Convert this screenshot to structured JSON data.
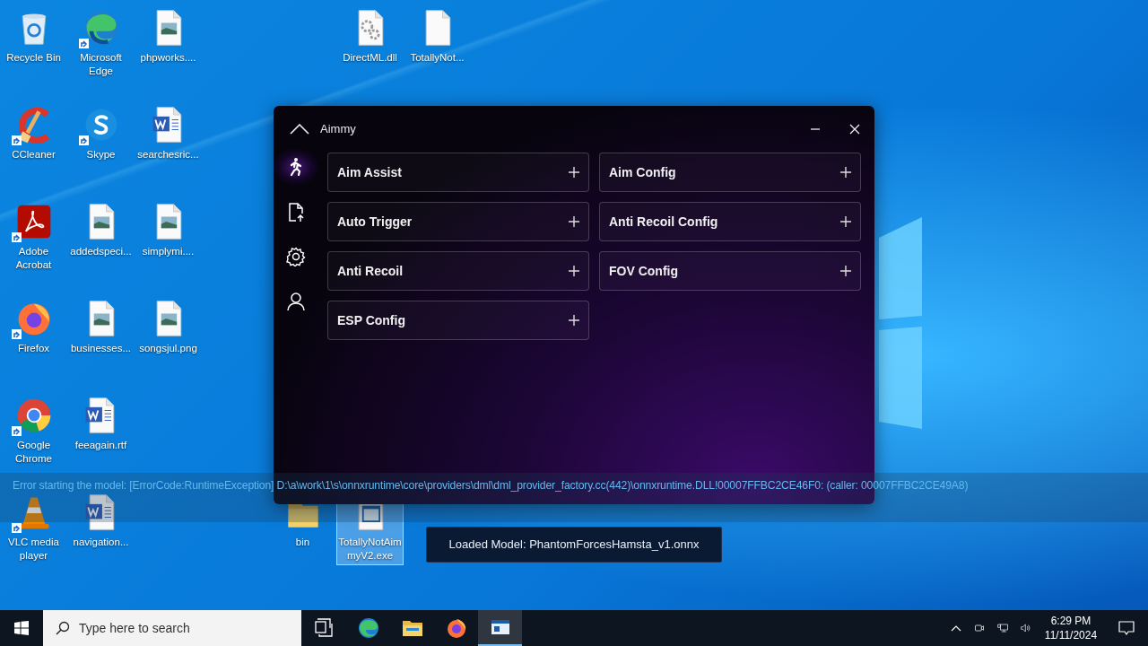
{
  "desktop_icons": [
    {
      "label": "Recycle Bin",
      "kind": "recycle",
      "shortcut": false,
      "selected": false
    },
    {
      "label": "CCleaner",
      "kind": "ccleaner",
      "shortcut": true,
      "selected": false
    },
    {
      "label": "Adobe Acrobat",
      "kind": "acrobat",
      "shortcut": true,
      "selected": false
    },
    {
      "label": "Firefox",
      "kind": "firefox",
      "shortcut": true,
      "selected": false
    },
    {
      "label": "Google Chrome",
      "kind": "chrome",
      "shortcut": true,
      "selected": false
    },
    {
      "label": "VLC media player",
      "kind": "vlc",
      "shortcut": true,
      "selected": false
    },
    {
      "label": "Microsoft Edge",
      "kind": "edge",
      "shortcut": true,
      "selected": false
    },
    {
      "label": "Skype",
      "kind": "skype",
      "shortcut": true,
      "selected": false
    },
    {
      "label": "addedspeci...",
      "kind": "image",
      "shortcut": false,
      "selected": false
    },
    {
      "label": "businesses...",
      "kind": "image",
      "shortcut": false,
      "selected": false
    },
    {
      "label": "feeagain.rtf",
      "kind": "word",
      "shortcut": false,
      "selected": false
    },
    {
      "label": "navigation...",
      "kind": "word",
      "shortcut": false,
      "selected": false
    },
    {
      "label": "phpworks....",
      "kind": "image",
      "shortcut": false,
      "selected": false
    },
    {
      "label": "searchesric...",
      "kind": "word",
      "shortcut": false,
      "selected": false
    },
    {
      "label": "simplymi....",
      "kind": "image",
      "shortcut": false,
      "selected": false
    },
    {
      "label": "songsjul.png",
      "kind": "image",
      "shortcut": false,
      "selected": false
    },
    {
      "label": "bin",
      "kind": "folder",
      "shortcut": false,
      "selected": false
    },
    {
      "label": "DirectML.dll",
      "kind": "dll",
      "shortcut": false,
      "selected": false
    },
    {
      "label": "TotallyNotAimmyV2.exe",
      "kind": "exe",
      "shortcut": false,
      "selected": true
    },
    {
      "label": "TotallyNot...",
      "kind": "blank",
      "shortcut": false,
      "selected": false
    }
  ],
  "app_window": {
    "title": "Aimmy",
    "sidebar": [
      {
        "kind": "runner",
        "selected": true
      },
      {
        "kind": "file-upload",
        "selected": false
      },
      {
        "kind": "gear",
        "selected": false
      },
      {
        "kind": "person",
        "selected": false
      }
    ],
    "columns": [
      [
        {
          "title": "Aim Assist",
          "expanded": false
        },
        {
          "title": "Auto Trigger",
          "expanded": false
        },
        {
          "title": "Anti Recoil",
          "expanded": false
        },
        {
          "title": "ESP Config",
          "expanded": false
        }
      ],
      [
        {
          "title": "Aim Config",
          "expanded": false
        },
        {
          "title": "Anti Recoil Config",
          "expanded": false
        },
        {
          "title": "FOV Config",
          "expanded": false
        }
      ]
    ]
  },
  "error_banner": "Error starting the model: [ErrorCode:RuntimeException] D:\\a\\work\\1\\s\\onnxruntime\\core\\providers\\dml\\dml_provider_factory.cc(442)\\onnxruntime.DLL!00007FFBC2CE46F0: (caller: 00007FFBC2CE49A8)",
  "toast": "Loaded Model: PhantomForcesHamsta_v1.onnx",
  "taskbar": {
    "search": {
      "placeholder": "Type here to search"
    },
    "apps": [
      {
        "kind": "task-view",
        "active": false
      },
      {
        "kind": "edge",
        "active": false
      },
      {
        "kind": "explorer",
        "active": false
      },
      {
        "kind": "firefox",
        "active": false
      },
      {
        "kind": "app",
        "active": true
      }
    ],
    "time": "6:29 PM",
    "date": "11/11/2024"
  }
}
